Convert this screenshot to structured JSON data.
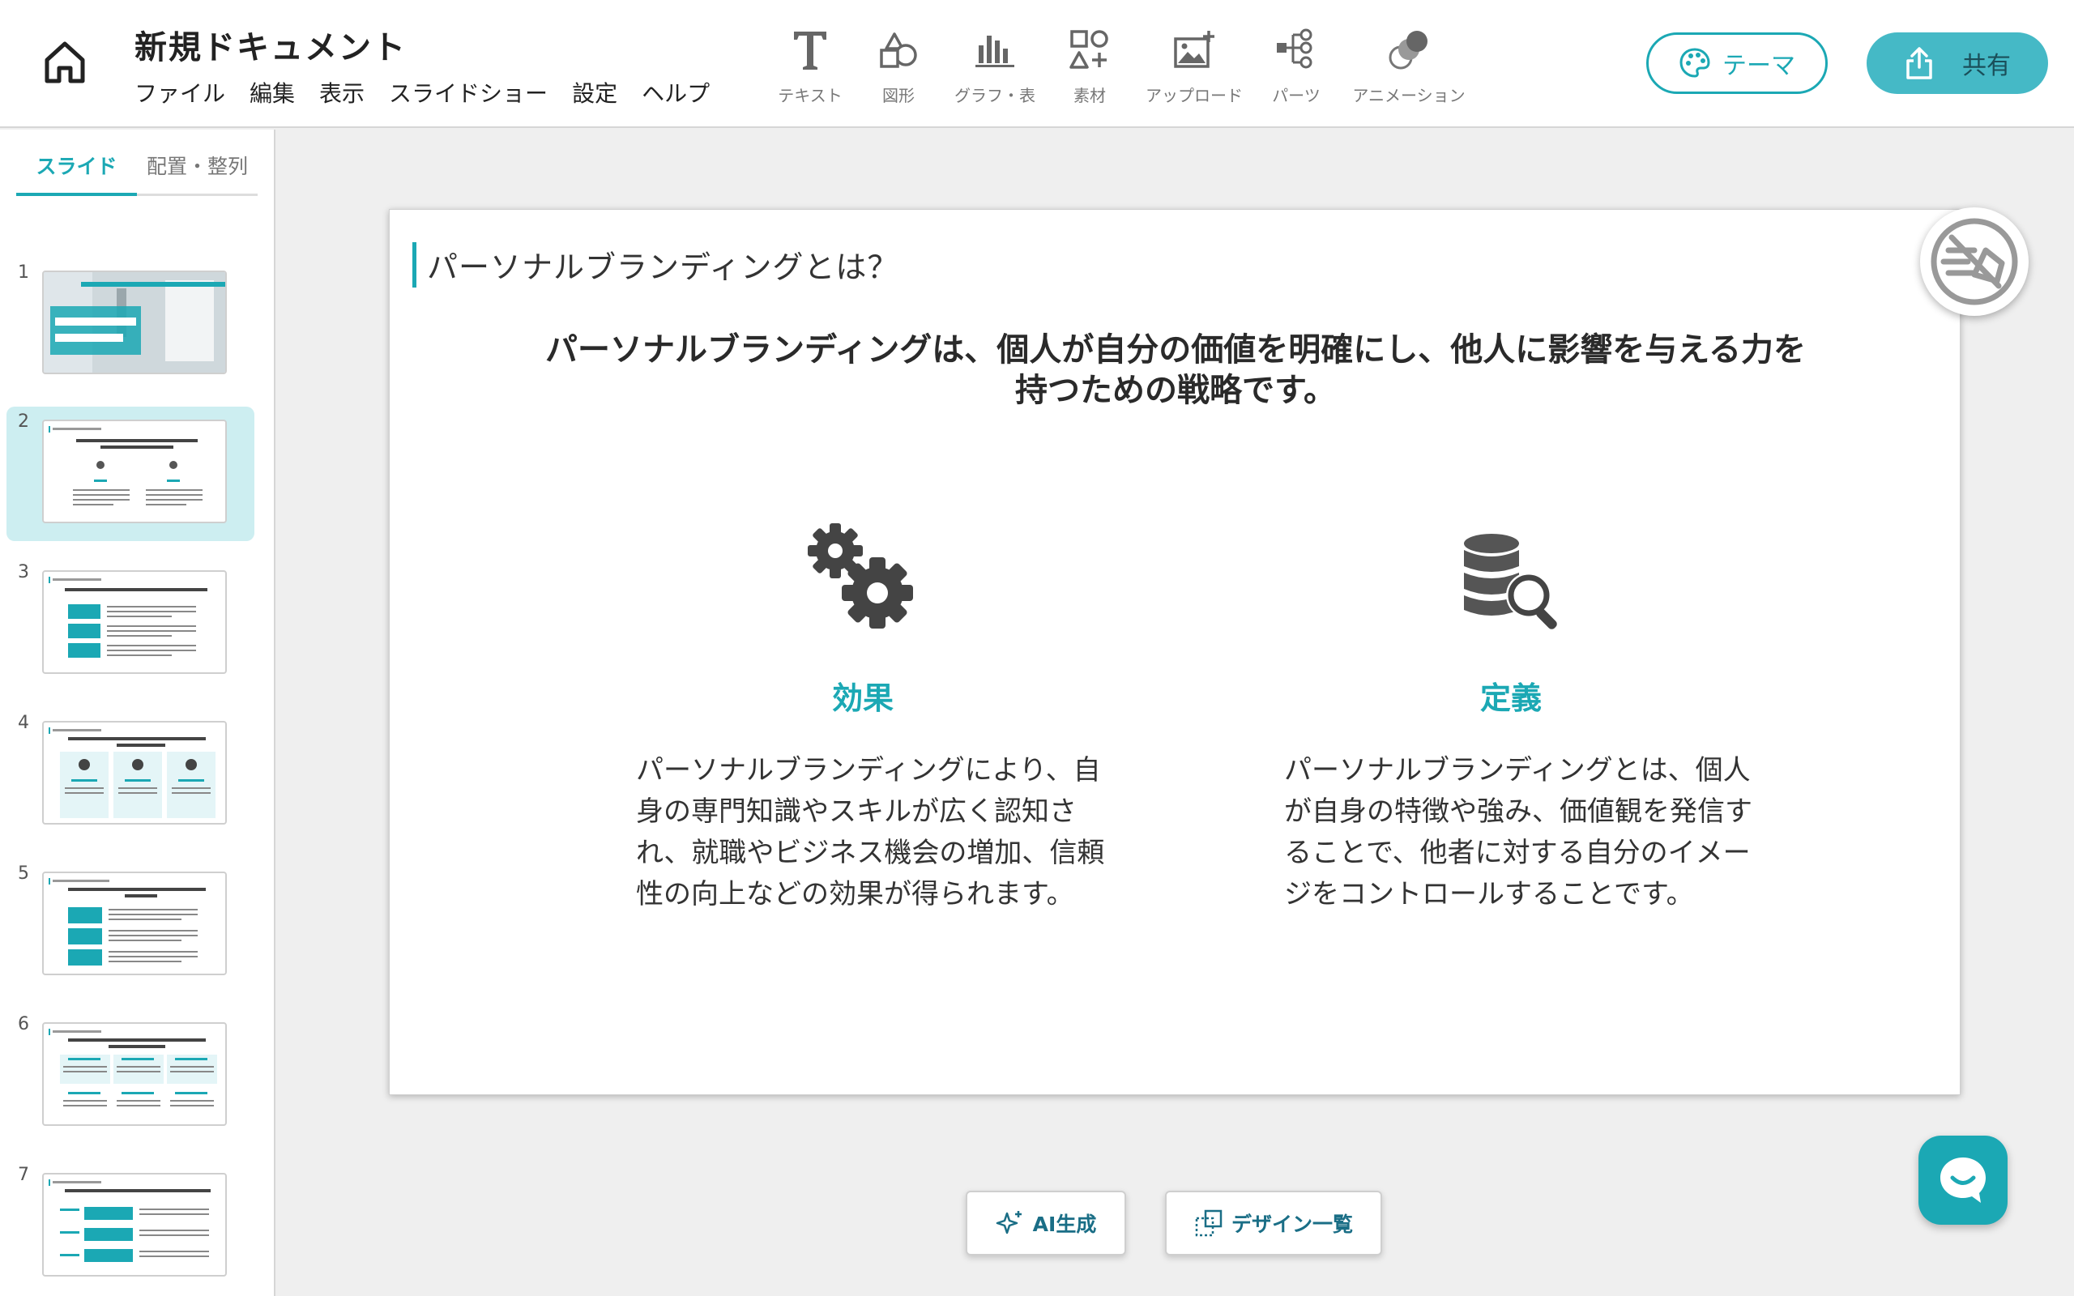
{
  "document": {
    "title": "新規ドキュメント"
  },
  "menu": [
    "ファイル",
    "編集",
    "表示",
    "スライドショー",
    "設定",
    "ヘルプ"
  ],
  "tools": [
    {
      "label": "テキスト",
      "icon": "text-icon"
    },
    {
      "label": "図形",
      "icon": "shapes-icon"
    },
    {
      "label": "グラフ・表",
      "icon": "chart-icon"
    },
    {
      "label": "素材",
      "icon": "elements-icon"
    },
    {
      "label": "アップロード",
      "icon": "upload-image-icon"
    },
    {
      "label": "パーツ",
      "icon": "parts-icon"
    },
    {
      "label": "アニメーション",
      "icon": "animation-icon"
    }
  ],
  "header_buttons": {
    "theme": "テーマ",
    "share": "共有"
  },
  "left_tabs": [
    "スライド",
    "配置・整列"
  ],
  "slides": [
    {
      "number": "1",
      "thumb_title": "パーソナルブランディングの作り方"
    },
    {
      "number": "2",
      "thumb_title": "パーソナルブランディングとは？"
    },
    {
      "number": "3",
      "thumb_title": ""
    },
    {
      "number": "4",
      "thumb_title": ""
    },
    {
      "number": "5",
      "thumb_title": ""
    },
    {
      "number": "6",
      "thumb_title": ""
    },
    {
      "number": "7",
      "thumb_title": ""
    }
  ],
  "current_slide": {
    "heading": "パーソナルブランディングとは？",
    "lead": "パーソナルブランディングは、個人が自分の価値を明確にし、他人に影響を与える力を持つための戦略です。",
    "columns": [
      {
        "title": "効果",
        "icon": "gears-icon",
        "text": "パーソナルブランディングにより、自身の専門知識やスキルが広く認知され、就職やビジネス機会の増加、信頼性の向上などの効果が得られます。"
      },
      {
        "title": "定義",
        "icon": "database-search-icon",
        "text": "パーソナルブランディングとは、個人が自身の特徴や強み、価値観を発信することで、他者に対する自分のイメージをコントロールすることです。"
      }
    ]
  },
  "bottom_buttons": {
    "ai": "AI生成",
    "design": "デザイン一覧"
  },
  "colors": {
    "accent": "#1ba8b4",
    "share_bg": "#45b9c6",
    "selected_slide_bg": "#cdeef1"
  }
}
